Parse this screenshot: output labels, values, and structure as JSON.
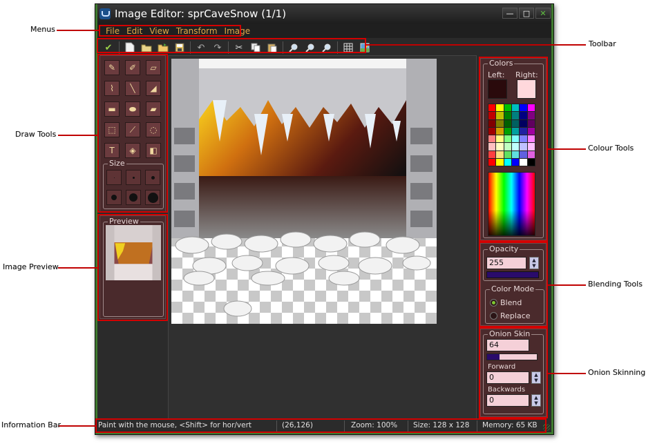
{
  "window": {
    "title": "Image Editor: sprCaveSnow (1/1)",
    "minimize": "—",
    "maximize": "□",
    "close": "✕"
  },
  "menubar": {
    "items": [
      "File",
      "Edit",
      "View",
      "Transform",
      "Image"
    ]
  },
  "toolbar": {
    "buttons": [
      "confirm-icon",
      "new-icon",
      "open-icon",
      "open-folder-icon",
      "save-icon",
      "undo-icon",
      "redo-icon",
      "cut-icon",
      "copy-icon",
      "paste-icon",
      "zoom-in-icon",
      "zoom-out-icon",
      "zoom-reset-icon",
      "grid-icon",
      "image-settings-icon"
    ]
  },
  "draw_tools": {
    "size_label": "Size"
  },
  "preview": {
    "label": "Preview"
  },
  "colors": {
    "label": "Colors",
    "left_label": "Left:",
    "right_label": "Right:",
    "left_color": "#2a0a0c",
    "right_color": "#ffd8dc",
    "palette": [
      "#ff0000",
      "#ffff00",
      "#00c000",
      "#00c0c0",
      "#0000ff",
      "#ff00ff",
      "#c00000",
      "#c0c000",
      "#008000",
      "#008080",
      "#000080",
      "#800080",
      "#800000",
      "#808000",
      "#006000",
      "#006060",
      "#000060",
      "#600060",
      "#a00000",
      "#d0a000",
      "#00a000",
      "#00a0a0",
      "#2020a0",
      "#a000a0",
      "#ff8080",
      "#ffff80",
      "#80ff80",
      "#80ffff",
      "#8080ff",
      "#ff80ff",
      "#ffc0c0",
      "#ffffc0",
      "#c0ffc0",
      "#c0ffff",
      "#c0c0ff",
      "#ffc0ff",
      "#ff4040",
      "#ffe080",
      "#60e060",
      "#60e0e0",
      "#6060e0",
      "#e060e0",
      "#ff0000",
      "#ffff00",
      "#00ffff",
      "#0000ff",
      "#ffffff",
      "#000000"
    ]
  },
  "blending": {
    "opacity_label": "Opacity",
    "opacity_value": "255",
    "opacity_fraction": 1.0,
    "color_mode_label": "Color Mode",
    "blend_label": "Blend",
    "replace_label": "Replace",
    "selected_mode": "Blend"
  },
  "onion": {
    "label": "Onion Skin",
    "value": "64",
    "slider_fraction": 0.25,
    "forward_label": "Forward",
    "forward_value": "0",
    "backwards_label": "Backwards",
    "backwards_value": "0"
  },
  "status": {
    "hint": "Paint with the mouse, <Shift> for hor/vert",
    "coords": "(26,126)",
    "zoom": "Zoom: 100%",
    "size": "Size: 128 x 128",
    "memory": "Memory: 65 KB"
  },
  "callouts": {
    "menus": "Menus",
    "toolbar": "Toolbar",
    "draw_tools": "Draw Tools",
    "image_preview": "Image Preview",
    "information_bar": "Information Bar",
    "colour_tools": "Colour Tools",
    "blending_tools": "Blending Tools",
    "onion_skinning": "Onion Skinning"
  }
}
